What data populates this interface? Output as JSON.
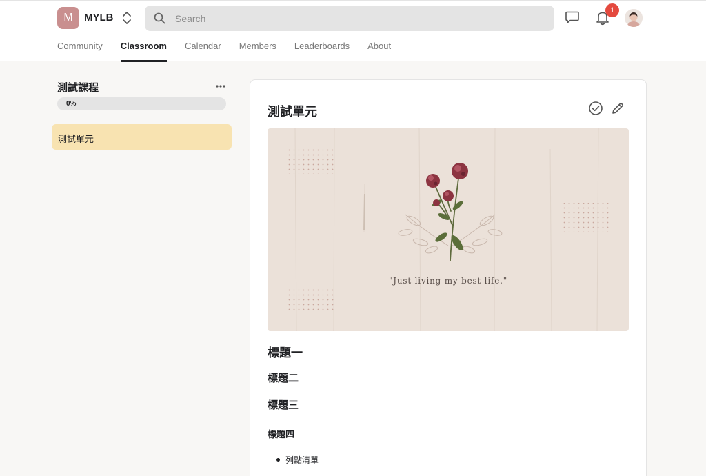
{
  "header": {
    "logo_letter": "M",
    "group_name": "MYLB",
    "search": {
      "placeholder": "Search",
      "value": ""
    },
    "notification_count": "1",
    "icons": [
      "switch-group-icon",
      "search-icon",
      "chat-icon",
      "bell-icon",
      "avatar"
    ]
  },
  "nav": {
    "tabs": [
      {
        "label": "Community",
        "active": false
      },
      {
        "label": "Classroom",
        "active": true
      },
      {
        "label": "Calendar",
        "active": false
      },
      {
        "label": "Members",
        "active": false
      },
      {
        "label": "Leaderboards",
        "active": false
      },
      {
        "label": "About",
        "active": false
      }
    ]
  },
  "sidebar": {
    "course_title": "測試課程",
    "progress": {
      "label": "0%",
      "fraction": 0
    },
    "modules": [
      {
        "label": "測試單元",
        "selected": true
      }
    ]
  },
  "main": {
    "module_title": "測試單元",
    "image_quote": "\"Just living my best life.\"",
    "headings": {
      "h1": "標題一",
      "h2": "標題二",
      "h3": "標題三",
      "h4": "標題四"
    },
    "bullets": [
      "列點清單"
    ]
  },
  "colors": {
    "logo_badge": "#c98f8f",
    "selected_module": "#f8e3b1",
    "notification_badge": "#e4493e",
    "page_background": "#f8f7f5"
  }
}
